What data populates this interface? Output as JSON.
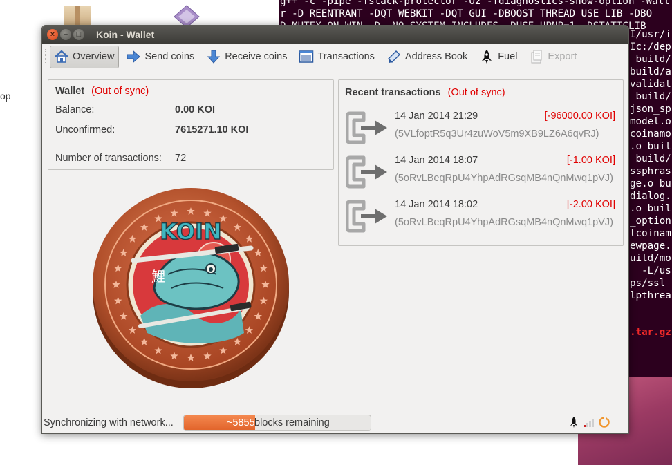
{
  "desktop": {
    "left_fragment": "op"
  },
  "terminal": {
    "lines": [
      "g++ -c -pipe -fstack-protector -O2 -fdiagnostics-show-option -Wall",
      "r -D_REENTRANT -DQT_WEBKIT -DQT_GUI -DBOOST_THREAD_USE_LIB -DBO",
      "D_MUTEX_ON_WIN -D__NO_SYSTEM_INCLUDES -DUSE_UPNP=1 -DSTATICLIB"
    ],
    "right_lines": [
      "I/usr/i",
      "Ic:/dep",
      "",
      " build/",
      "build/a",
      "validat",
      " build/",
      "json_sp",
      "model.o",
      "coinamo",
      ".o buil",
      " build/",
      "ssphras",
      "ge.o bu",
      "dialog.",
      ".o buil",
      "_option",
      "tcoinam",
      "ewpage.",
      "uild/mo",
      "  -L/us",
      "ps/ssl ",
      "lpthrea"
    ],
    "red_text": ".tar.gz",
    "colors": {
      "bg": "#2c001e",
      "fg": "#ffffff",
      "error": "#ef2929"
    }
  },
  "window": {
    "title": "Koin - Wallet",
    "close_glyph": "×",
    "minimize_glyph": "–",
    "maximize_glyph": "□"
  },
  "toolbar": {
    "items": [
      {
        "label": "Overview",
        "icon": "home-icon",
        "active": true
      },
      {
        "label": "Send coins",
        "icon": "arrow-right-icon"
      },
      {
        "label": "Receive coins",
        "icon": "arrow-down-icon"
      },
      {
        "label": "Transactions",
        "icon": "list-icon"
      },
      {
        "label": "Address Book",
        "icon": "address-book-icon"
      },
      {
        "label": "Fuel",
        "icon": "rocket-icon"
      },
      {
        "label": "Export",
        "icon": "export-icon",
        "disabled": true
      }
    ]
  },
  "wallet": {
    "title": "Wallet",
    "status": "(Out of sync)",
    "balance_label": "Balance:",
    "balance_value": "0.00 KOI",
    "unconfirmed_label": "Unconfirmed:",
    "unconfirmed_value": "7615271.10 KOI",
    "tx_count_label": "Number of transactions:",
    "tx_count_value": "72"
  },
  "recent": {
    "title": "Recent transactions",
    "status": "(Out of sync)",
    "items": [
      {
        "date": "14 Jan 2014 21:29",
        "amount": "[-96000.00 KOI]",
        "address": "(5VLfoptR5q3Ur4zuWoV5m9XB9LZ6A6qvRJ)"
      },
      {
        "date": "14 Jan 2014 18:07",
        "amount": "[-1.00 KOI]",
        "address": "(5oRvLBeqRpU4YhpAdRGsqMB4nQnMwq1pVJ)"
      },
      {
        "date": "14 Jan 2014 18:02",
        "amount": "[-2.00 KOI]",
        "address": "(5oRvLBeqRpU4YhpAdRGsqMB4nQnMwq1pVJ)"
      }
    ]
  },
  "coin": {
    "logo_text": "KOIN",
    "kanji": "鯉"
  },
  "status": {
    "label": "Synchronizing with network...",
    "progress_count": "~5855",
    "progress_suffix": "blocks remaining",
    "progress_fraction": 0.38
  },
  "colors": {
    "accent_orange": "#e8692f",
    "out_of_sync": "#e00000",
    "negative_amount": "#e00000",
    "address_gray": "#8a8a8a"
  }
}
